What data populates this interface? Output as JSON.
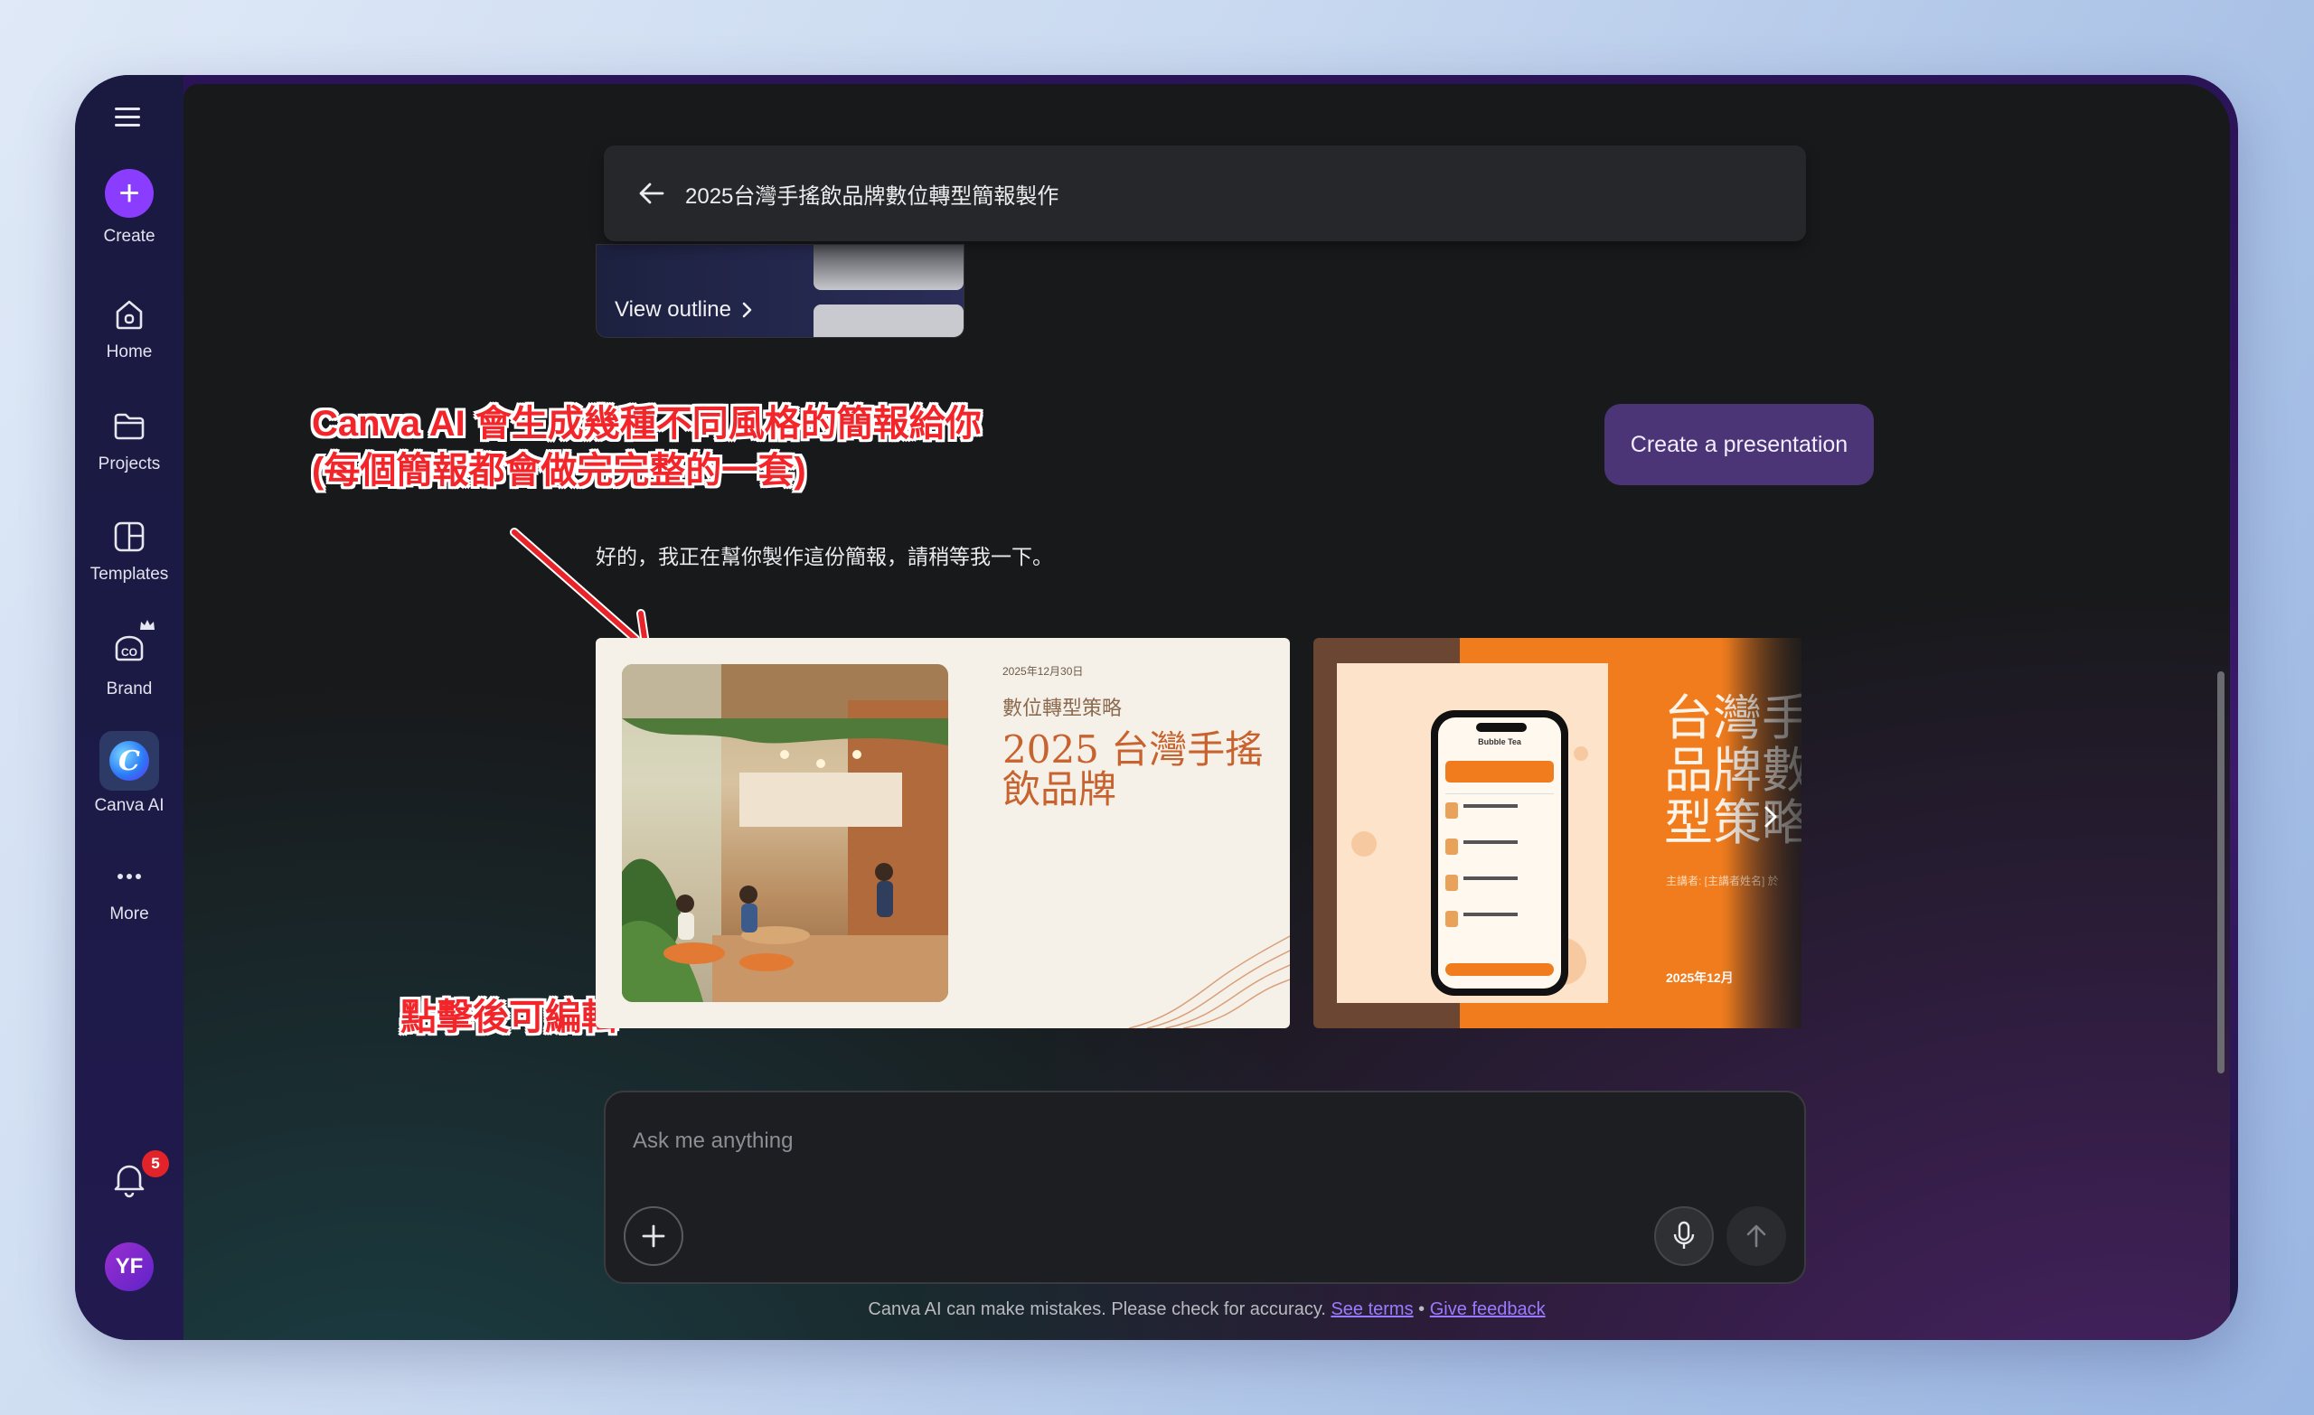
{
  "sidebar": {
    "create_label": "Create",
    "items": [
      {
        "label": "Home"
      },
      {
        "label": "Projects"
      },
      {
        "label": "Templates"
      },
      {
        "label": "Brand"
      },
      {
        "label": "Canva AI"
      },
      {
        "label": "More"
      }
    ],
    "notifications_count": "5",
    "avatar_initials": "YF"
  },
  "header": {
    "title": "2025台灣手搖飲品牌數位轉型簡報製作"
  },
  "outline": {
    "view_label": "View outline"
  },
  "actions": {
    "create_presentation": "Create a presentation"
  },
  "annotations": {
    "line1": "Canva AI 會生成幾種不同風格的簡報給你",
    "line2": "(每個簡報都會做完完整的一套)",
    "edit_hint": "點擊後可編輯"
  },
  "chat": {
    "reply": "好的，我正在幫你製作這份簡報，請稍等我一下。"
  },
  "slides": [
    {
      "date": "2025年12月30日",
      "subtitle": "數位轉型策略",
      "title": "2025 台灣手搖飲品牌"
    },
    {
      "title_line1": "台灣手",
      "title_line2": "品牌數",
      "title_line3": "型策略",
      "speaker": "主講者: [主講者姓名] 於",
      "date": "2025年12月",
      "phone_app_name": "Bubble Tea"
    }
  ],
  "composer": {
    "placeholder": "Ask me anything"
  },
  "footer": {
    "disclaimer": "Canva AI can make mistakes. Please check for accuracy.",
    "see_terms": "See terms",
    "separator": "•",
    "feedback": "Give feedback"
  },
  "colors": {
    "accent": "#8b3dff",
    "annotation_red": "#f2262a",
    "create_presentation_bg": "#4b3576",
    "slide2_orange": "#f07c1d"
  }
}
